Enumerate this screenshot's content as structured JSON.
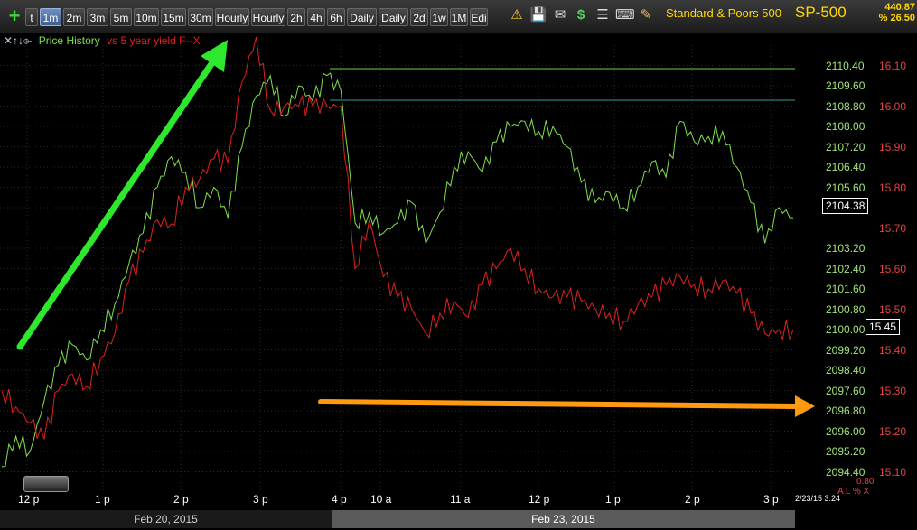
{
  "toolbar": {
    "tabs": [
      "t",
      "1m",
      "2m",
      "3m",
      "5m",
      "10m",
      "15m",
      "30m",
      "Hourly",
      "Hourly",
      "2h",
      "4h",
      "6h",
      "Daily",
      "Daily",
      "2d",
      "1w",
      "1M",
      "Edi"
    ],
    "active_tab": "1m",
    "symbol_name": "Standard & Poors 500",
    "symbol": "SP-500",
    "quote_line1": "440.87",
    "quote_line2": "% 26.50"
  },
  "legend": {
    "icons": "✕↑↓⌱",
    "series1": "Price History",
    "series2": "vs 5 year yield F",
    "series2_tail": "--X"
  },
  "colors": {
    "price": "#7fe04a",
    "yield": "#e02020",
    "arrow_up": "#2ee82e",
    "arrow_right": "#ff9a10",
    "yellow": "#ffd800"
  },
  "y_left_ticks": [
    "2110.40",
    "2109.60",
    "2108.80",
    "2108.00",
    "2107.20",
    "2106.40",
    "2105.60",
    "2104.80",
    "2103.20",
    "2102.40",
    "2101.60",
    "2100.80",
    "2100.00",
    "2099.20",
    "2098.40",
    "2097.60",
    "2096.80",
    "2096.00",
    "2095.20",
    "2094.40"
  ],
  "y_right_ticks": [
    "16.10",
    "16.00",
    "15.90",
    "15.80",
    "15.70",
    "15.60",
    "15.50",
    "15.40",
    "15.30",
    "15.20",
    "15.10"
  ],
  "price_badge": "2104.38",
  "yield_badge": "15.45",
  "x_ticks": [
    "12 p",
    "1 p",
    "2 p",
    "3 p",
    "4 p",
    "10 a",
    "11 a",
    "12 p",
    "1 p",
    "2 p",
    "3 p"
  ],
  "dates": {
    "left": "Feb 20, 2015",
    "right": "Feb 23, 2015"
  },
  "timestamp": "2/23/15 3:24",
  "alx": {
    "value": "0.80",
    "label": "A L % X"
  },
  "chart_data": {
    "type": "line",
    "x_categories": [
      "12 p",
      "1 p",
      "2 p",
      "3 p",
      "4 p",
      "10 a",
      "11 a",
      "12 p",
      "1 p",
      "2 p",
      "3 p"
    ],
    "y_left_range": [
      2093.6,
      2111.2
    ],
    "y_right_range": [
      15.05,
      16.15
    ],
    "series": [
      {
        "name": "Price History",
        "axis": "left",
        "values": [
          2094.6,
          2095.8,
          2095.2,
          2097.2,
          2098.6,
          2099.4,
          2098.8,
          2100.0,
          2101.0,
          2102.6,
          2103.8,
          2105.6,
          2106.8,
          2106.2,
          2104.8,
          2105.6,
          2104.4,
          2107.2,
          2109.2,
          2110.0,
          2108.4,
          2109.6,
          2109.0,
          2110.0,
          2109.4,
          2104.2,
          2104.6,
          2103.8,
          2104.2,
          2105.0,
          2103.4,
          2104.6,
          2106.4,
          2107.0,
          2106.2,
          2107.4,
          2108.0,
          2108.2,
          2107.8,
          2108.0,
          2107.2,
          2105.8,
          2105.0,
          2105.4,
          2104.8,
          2105.6,
          2106.6,
          2106.0,
          2108.2,
          2107.4,
          2107.6,
          2107.8,
          2106.4,
          2105.0,
          2103.4,
          2104.8,
          2104.4
        ]
      },
      {
        "name": "vs 5 year yield F",
        "axis": "right",
        "values": [
          15.3,
          15.26,
          15.22,
          15.18,
          15.3,
          15.34,
          15.31,
          15.38,
          15.44,
          15.57,
          15.64,
          15.72,
          15.71,
          15.8,
          15.82,
          15.87,
          15.86,
          16.06,
          16.17,
          15.99,
          16.0,
          16.0,
          16.0,
          16.0,
          16.0,
          15.6,
          15.72,
          15.58,
          15.53,
          15.5,
          15.44,
          15.49,
          15.52,
          15.48,
          15.56,
          15.6,
          15.65,
          15.6,
          15.55,
          15.53,
          15.53,
          15.52,
          15.5,
          15.49,
          15.47,
          15.51,
          15.53,
          15.56,
          15.58,
          15.56,
          15.55,
          15.57,
          15.54,
          15.49,
          15.44,
          15.45,
          15.45
        ]
      }
    ]
  }
}
